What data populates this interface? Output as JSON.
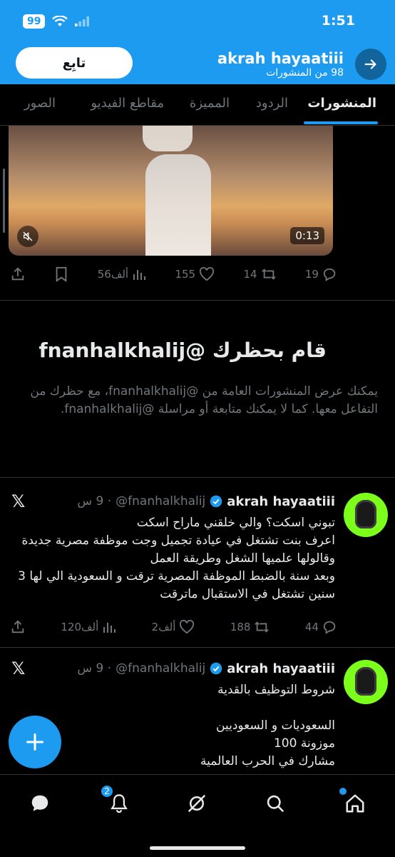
{
  "status_bar": {
    "time": "1:51",
    "battery": "99"
  },
  "header": {
    "title": "akrah hayaatiii",
    "subtitle": "98 من المنشورات",
    "follow_label": "تابِع"
  },
  "tabs": [
    {
      "label": "المنشورات",
      "active": true
    },
    {
      "label": "الردود",
      "active": false
    },
    {
      "label": "المميزة",
      "active": false
    },
    {
      "label": "مقاطع الفيديو",
      "active": false
    },
    {
      "label": "الصور",
      "active": false
    }
  ],
  "video_post": {
    "duration": "0:13",
    "replies": "19",
    "reposts": "14",
    "likes": "155",
    "views": "56ألف"
  },
  "blocked_notice": {
    "title": "قام بحظرك @fnanhalkhalij",
    "text": "يمكنك عرض المنشورات العامة من @fnanhalkhalij، مع حظرك من التفاعل معها. كما لا يمكنك متابعة أو مراسلة @fnanhalkhalij."
  },
  "tweets": [
    {
      "name": "akrah hayaatiii",
      "handle": "@fnanhalkhalij",
      "time": "· 9 س",
      "lines": [
        "تبوني اسكت؟ والي خلقني ماراح اسكت",
        "اعرف بنت تشتغل في عيادة تجميل وجت موظفة مصرية جديدة وقالولها علميها الشغل وطريقة العمل",
        "وبعد سنة بالضبط الموظفة المصرية ترقت و السعودية الي لها 3 سنين تشتغل في الاستقبال ماترقت"
      ],
      "replies": "44",
      "reposts": "188",
      "likes": "2ألف",
      "views": "120ألف"
    },
    {
      "name": "akrah hayaatiii",
      "handle": "@fnanhalkhalij",
      "time": "· 9 س",
      "lines": [
        "شروط التوظيف بالقدية",
        "",
        "السعوديات و السعوديين",
        "موزونة 100",
        "مشارك في الحرب العالمية"
      ]
    }
  ],
  "bottom_nav": {
    "notifications_badge": "2"
  },
  "colors": {
    "accent": "#1d9bf0",
    "background": "#000000",
    "secondary_text": "#71767b"
  }
}
